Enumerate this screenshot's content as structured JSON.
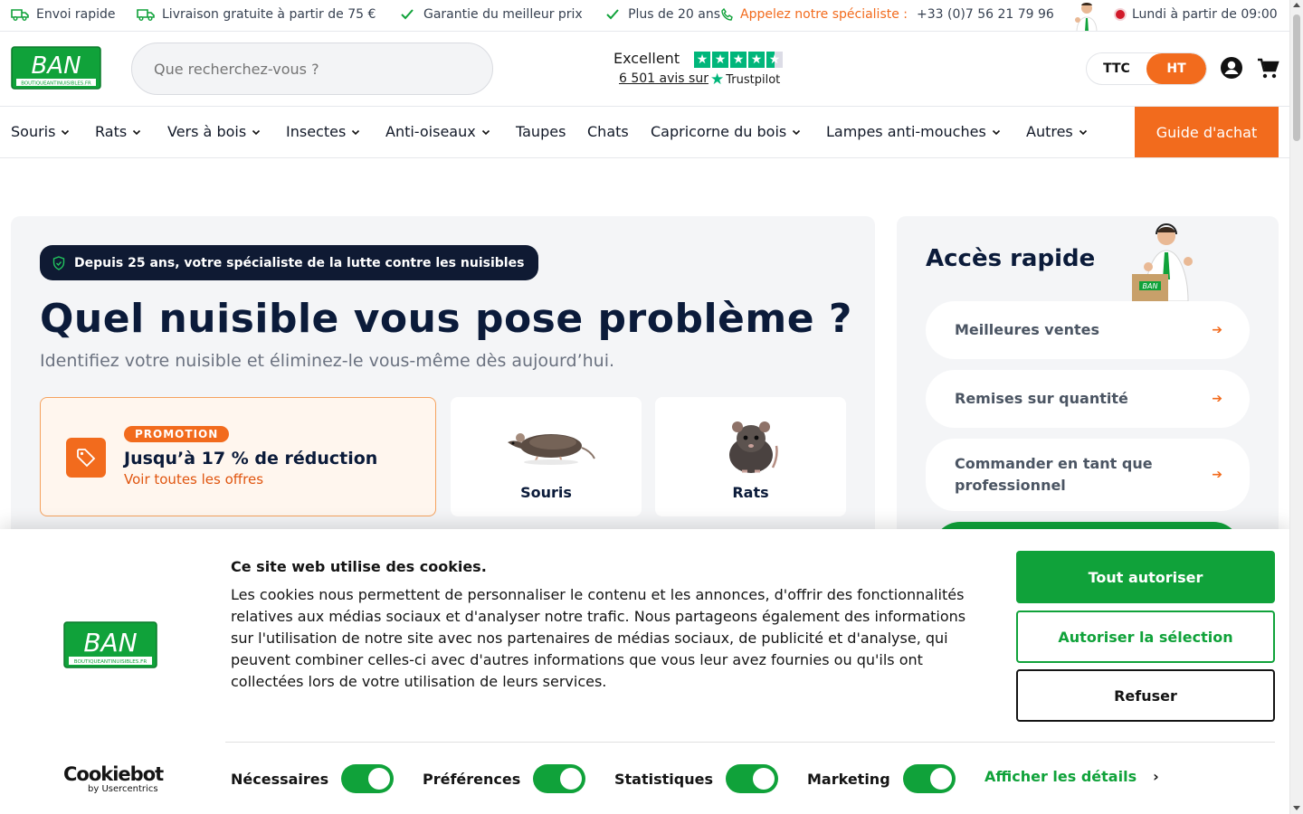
{
  "topbar": {
    "items": [
      "Envoi rapide",
      "Livraison gratuite à partir de 75 €",
      "Garantie du meilleur prix",
      "Plus de 20 ans"
    ],
    "specialist_label": "Appelez notre spécialiste :",
    "phone": "+33 (0)7 56 21 79 96",
    "hours": "Lundi à partir de 09:00"
  },
  "header": {
    "logo_text": "BAN",
    "logo_subtext": "BOUTIQUEANTINUISIBLES.FR",
    "search_placeholder": "Que recherchez-vous ?",
    "trustpilot": {
      "rating_label": "Excellent",
      "reviews": "6 501 avis sur",
      "brand": "Trustpilot",
      "stars": 4.5
    },
    "price_toggle": {
      "ttc": "TTC",
      "ht": "HT",
      "active": "HT"
    }
  },
  "nav": {
    "items": [
      {
        "label": "Souris",
        "dropdown": true
      },
      {
        "label": "Rats",
        "dropdown": true
      },
      {
        "label": "Vers à bois",
        "dropdown": true
      },
      {
        "label": "Insectes",
        "dropdown": true
      },
      {
        "label": "Anti-oiseaux",
        "dropdown": true
      },
      {
        "label": "Taupes",
        "dropdown": false
      },
      {
        "label": "Chats",
        "dropdown": false
      },
      {
        "label": "Capricorne du bois",
        "dropdown": true
      },
      {
        "label": "Lampes anti-mouches",
        "dropdown": true
      },
      {
        "label": "Autres",
        "dropdown": true
      }
    ],
    "guide": "Guide d'achat"
  },
  "hero": {
    "badge": "Depuis 25 ans, votre spécialiste de la lutte contre les nuisibles",
    "title": "Quel nuisible vous pose problème ?",
    "subtitle": "Identifiez votre nuisible et éliminez-le vous-même dès aujourd’hui.",
    "promo": {
      "label": "PROMOTION",
      "title": "Jusqu’à 17 % de réduction",
      "link": "Voir toutes les offres"
    },
    "pests": [
      "Souris",
      "Rats"
    ]
  },
  "quick": {
    "title": "Accès rapide",
    "buttons": [
      "Meilleures ventes",
      "Remises sur quantité",
      "Commander en tant que professionnel"
    ]
  },
  "cookie": {
    "title": "Ce site web utilise des cookies.",
    "text": "Les cookies nous permettent de personnaliser le contenu et les annonces, d'offrir des fonctionnalités relatives aux médias sociaux et d'analyser notre trafic. Nous partageons également des informations sur l'utilisation de notre site avec nos partenaires de médias sociaux, de publicité et d'analyse, qui peuvent combiner celles-ci avec d'autres informations que vous leur avez fournies ou qu'ils ont collectées lors de votre utilisation de leurs services.",
    "allow_all": "Tout autoriser",
    "allow_selection": "Autoriser la sélection",
    "refuse": "Refuser",
    "categories": [
      "Nécessaires",
      "Préférences",
      "Statistiques",
      "Marketing"
    ],
    "show_details": "Afficher les détails",
    "cookiebot": "Cookiebot",
    "cookiebot_sub": "by Usercentrics"
  },
  "colors": {
    "accent": "#f26b1d",
    "brand_green": "#10a23a",
    "navy": "#0b1b3a",
    "trustpilot": "#00b67a"
  }
}
